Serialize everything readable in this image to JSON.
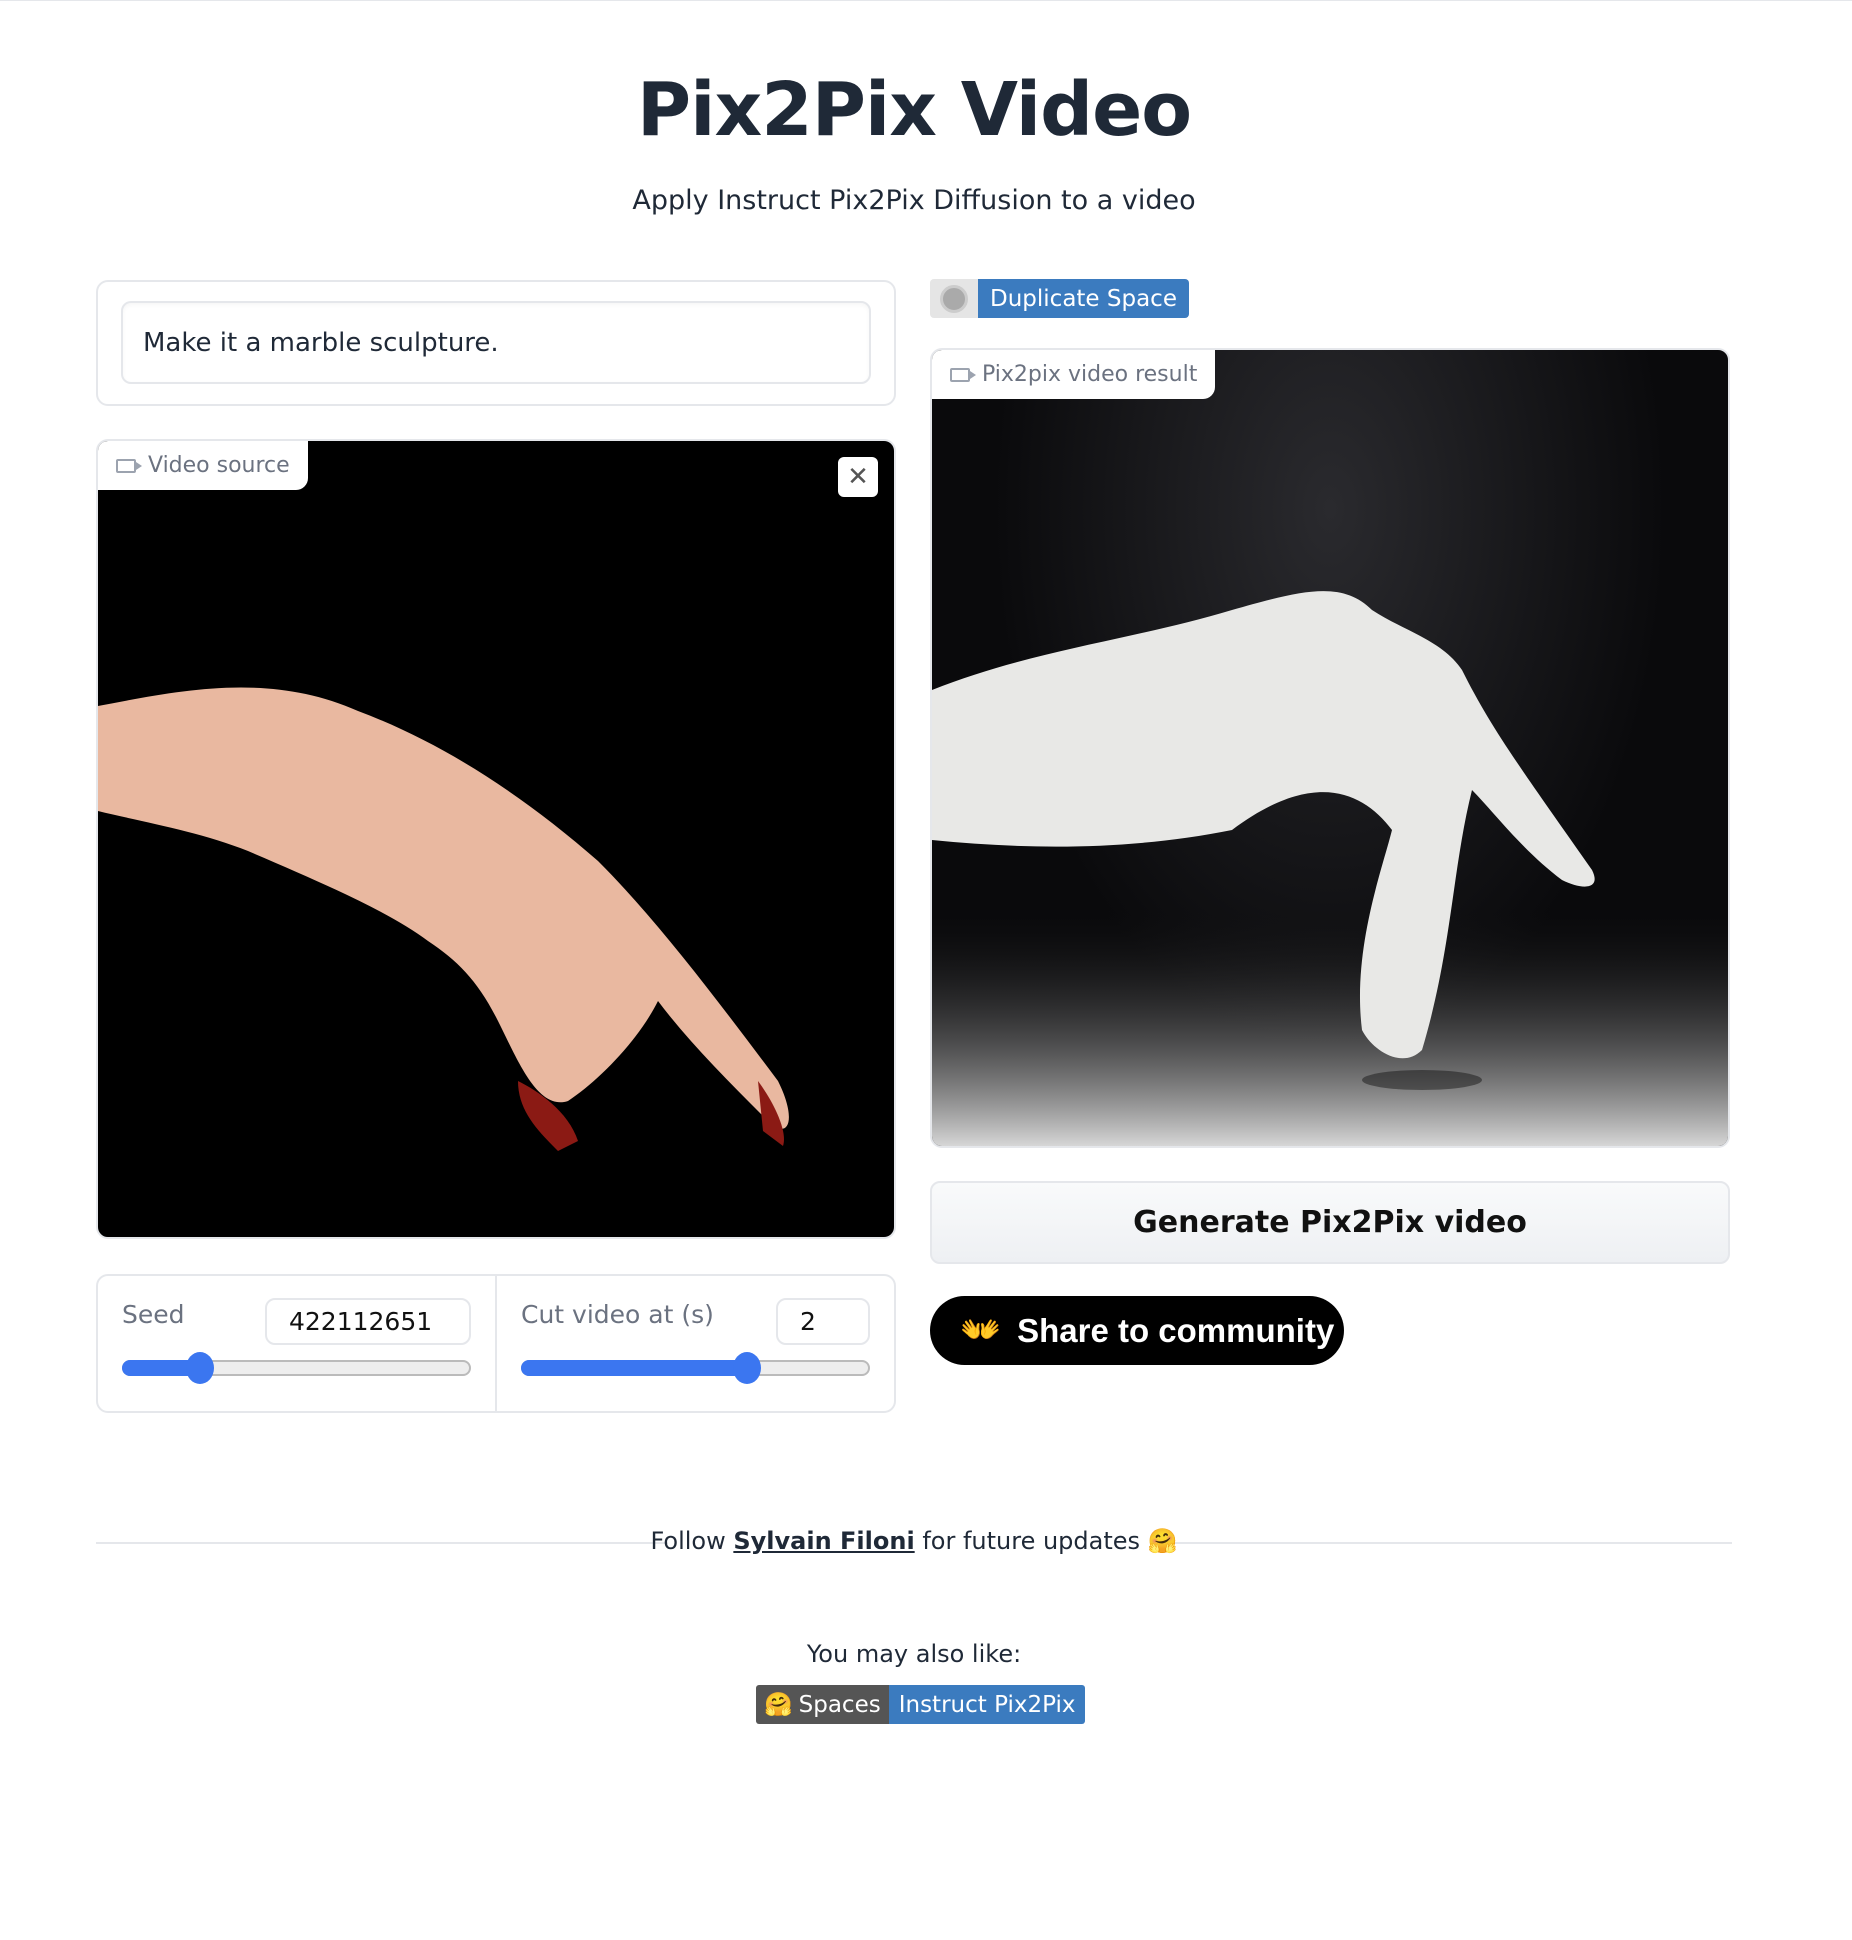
{
  "header": {
    "title": "Pix2Pix Video",
    "subtitle": "Apply Instruct Pix2Pix Diffusion to a video"
  },
  "prompt": {
    "value": "Make it a marble sculpture."
  },
  "video_source": {
    "label": "Video source",
    "icon": "video-camera-icon",
    "close_icon": "close-icon"
  },
  "duplicate": {
    "label": "Duplicate Space"
  },
  "result": {
    "label": "Pix2pix video result",
    "icon": "video-camera-icon"
  },
  "generate": {
    "label": "Generate Pix2Pix video"
  },
  "share": {
    "label": "Share to community",
    "emoji": "👐"
  },
  "seed": {
    "label": "Seed",
    "value": "422112651",
    "slider_fraction": 0.22
  },
  "cut": {
    "label": "Cut video at (s)",
    "value": "2",
    "slider_fraction": 0.65
  },
  "footer": {
    "follow_prefix": "Follow",
    "author": "Sylvain Filoni",
    "follow_suffix": "for future updates",
    "emoji": "🤗",
    "also_like": "You may also like:",
    "badge_left": "Spaces",
    "badge_emoji": "🤗",
    "badge_right": "Instruct Pix2Pix"
  },
  "colors": {
    "accent": "#3b76f0",
    "badge_blue": "#3b7bbf"
  }
}
